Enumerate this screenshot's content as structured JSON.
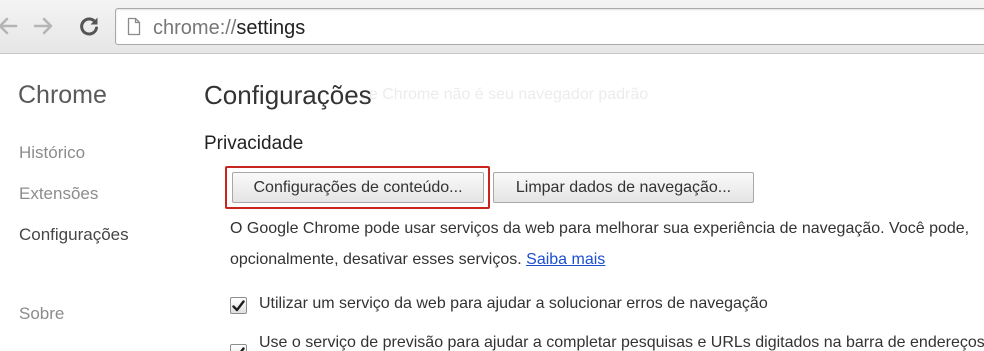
{
  "toolbar": {
    "url_scheme": "chrome://",
    "url_path": "settings"
  },
  "icons": {
    "back": "arrow-left-icon",
    "forward": "arrow-right-icon",
    "reload": "reload-icon",
    "page": "page-icon",
    "check": "checkmark-icon"
  },
  "sidebar": {
    "title": "Chrome",
    "items": [
      {
        "label": "Histórico"
      },
      {
        "label": "Extensões"
      },
      {
        "label": "Configurações"
      },
      {
        "label": "Sobre"
      }
    ],
    "active_index": 2
  },
  "main": {
    "ghost_text": "ge Chrome não é seu navegador padrão",
    "title": "Configurações",
    "section": "Privacidade",
    "buttons": {
      "content_settings": "Configurações de conteúdo...",
      "clear_data": "Limpar dados de navegação..."
    },
    "description_line1": "O Google Chrome pode usar serviços da web para melhorar sua experiência de navegação. Você pode,",
    "description_line2": "opcionalmente, desativar esses serviços.",
    "learn_more": "Saiba mais",
    "options": [
      {
        "label": "Utilizar um serviço da web para ajudar a solucionar erros de navegação",
        "checked": true
      },
      {
        "label": "Use o serviço de previsão para ajudar a completar pesquisas e URLs digitados na barra de endereços",
        "checked": true
      }
    ]
  },
  "colors": {
    "highlight": "#c8251c",
    "link": "#1a4fcf"
  }
}
